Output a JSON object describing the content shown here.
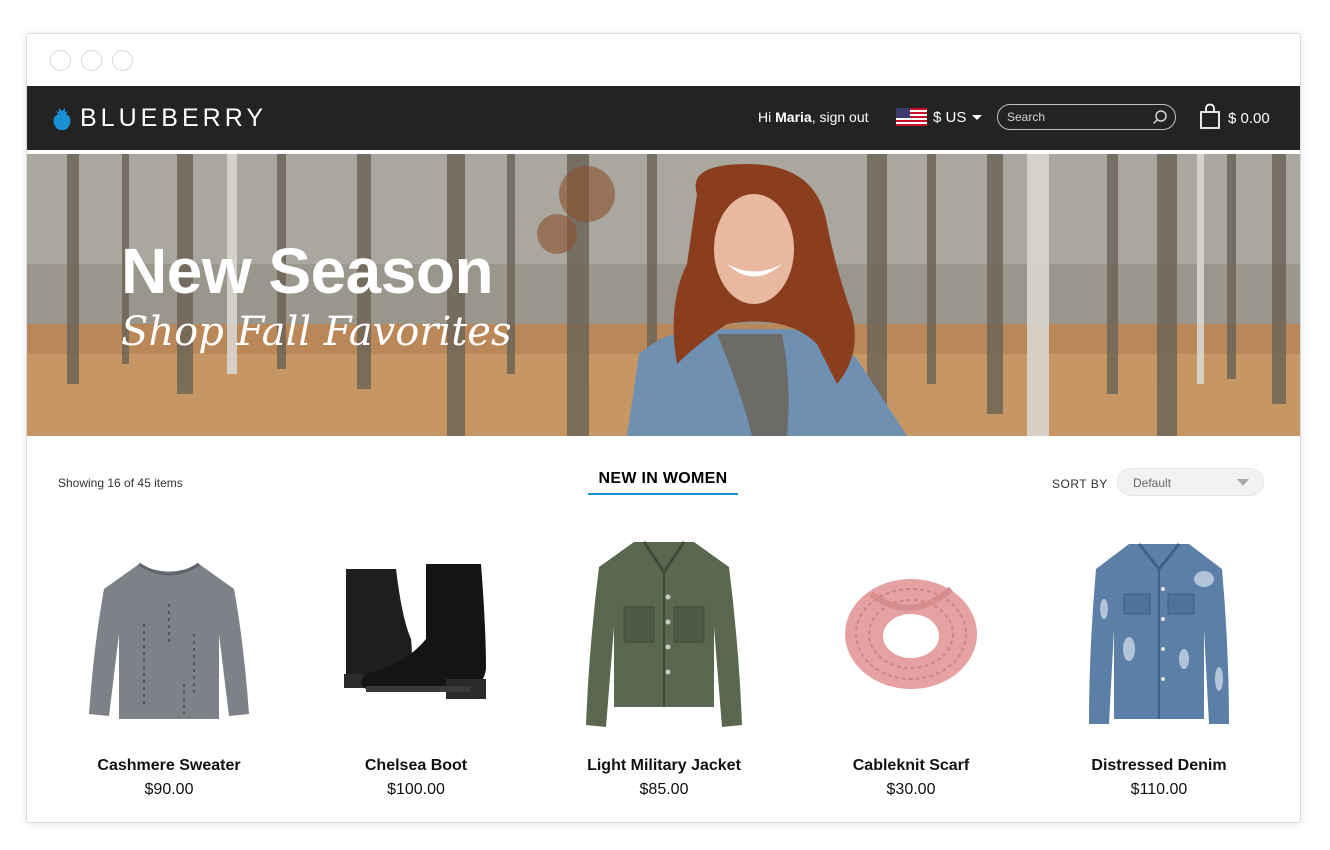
{
  "header": {
    "brand": "BLUEBERRY",
    "greeting_prefix": "Hi ",
    "user_name": "Maria",
    "signout": ", sign out",
    "currency": "$ US",
    "search_placeholder": "Search",
    "cart_total": "$ 0.00",
    "colors": {
      "bar": "#232323",
      "logo_accent": "#1a8fd4"
    }
  },
  "hero": {
    "title": "New Season",
    "subtitle": "Shop Fall Favorites"
  },
  "listing": {
    "count_text": "Showing 16 of 45 items",
    "section_title": "NEW IN WOMEN",
    "sort_label": "SORT BY",
    "sort_value": "Default"
  },
  "products": [
    {
      "name": "Cashmere Sweater",
      "price": "$90.00",
      "icon": "sweater-image"
    },
    {
      "name": "Chelsea Boot",
      "price": "$100.00",
      "icon": "boots-image"
    },
    {
      "name": "Light Military Jacket",
      "price": "$85.00",
      "icon": "military-jacket-image"
    },
    {
      "name": "Cableknit Scarf",
      "price": "$30.00",
      "icon": "scarf-image"
    },
    {
      "name": "Distressed Denim",
      "price": "$110.00",
      "icon": "denim-jacket-image"
    }
  ]
}
